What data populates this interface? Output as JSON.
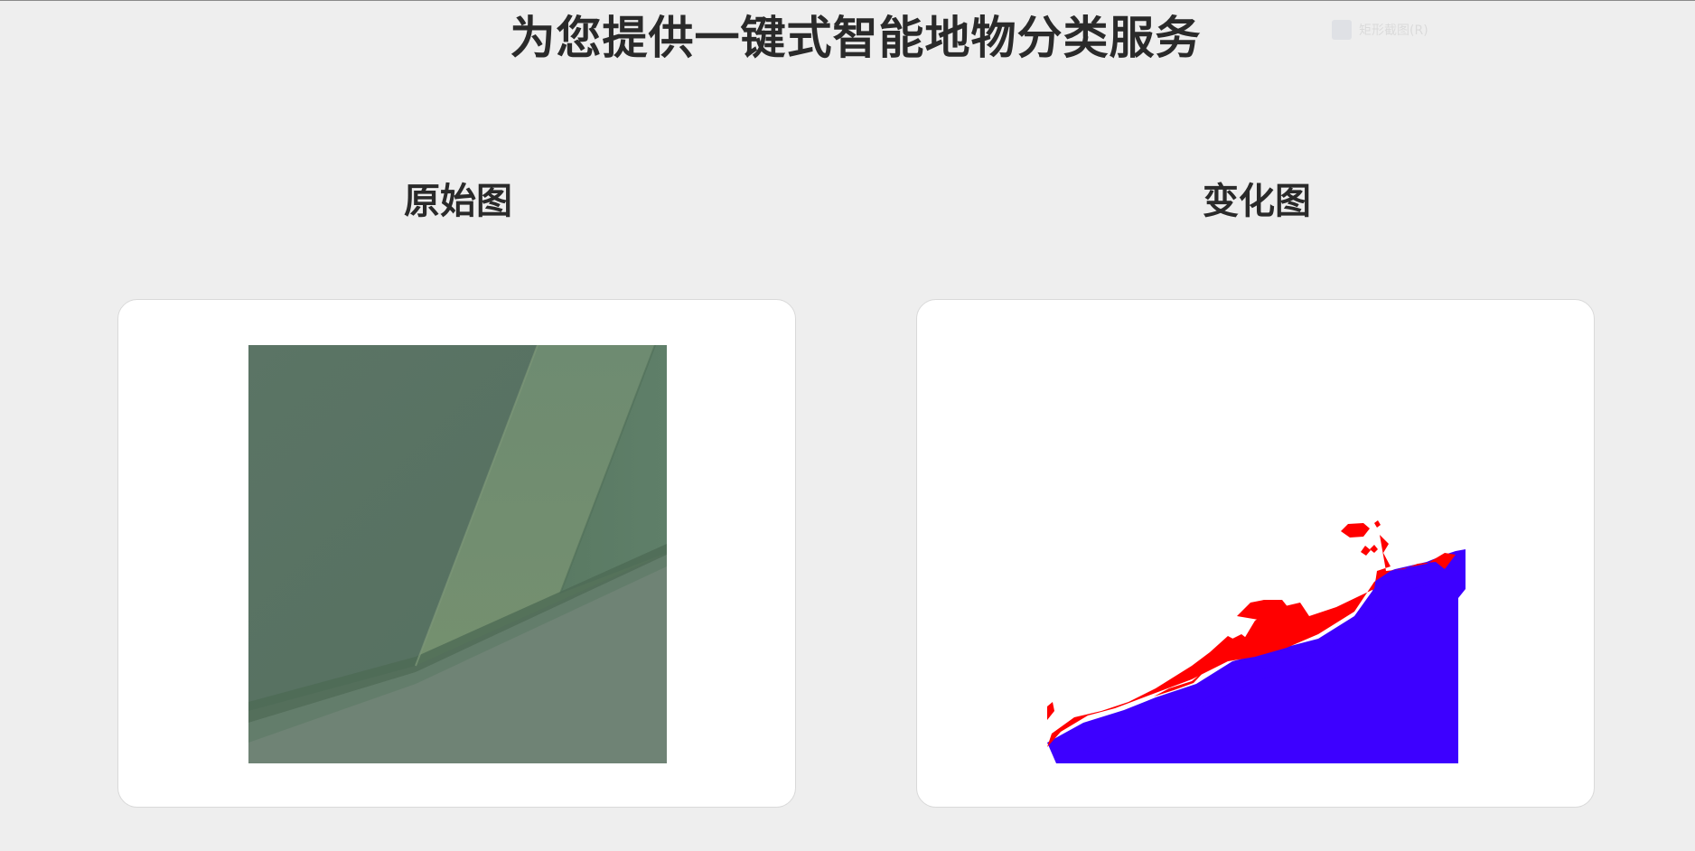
{
  "page": {
    "title": "为您提供一键式智能地物分类服务",
    "badge_text": "矩形截图(R)"
  },
  "sections": {
    "original": {
      "title": "原始图",
      "image_icon": "aerial-photo-icon"
    },
    "change": {
      "title": "变化图",
      "image_icon": "classification-map-icon"
    }
  },
  "colors": {
    "background": "#eeeeee",
    "card": "#ffffff",
    "change_red": "#ff0000",
    "change_blue": "#3d00ff",
    "field_dark": "#5d7767",
    "field_light": "#6f8774"
  }
}
